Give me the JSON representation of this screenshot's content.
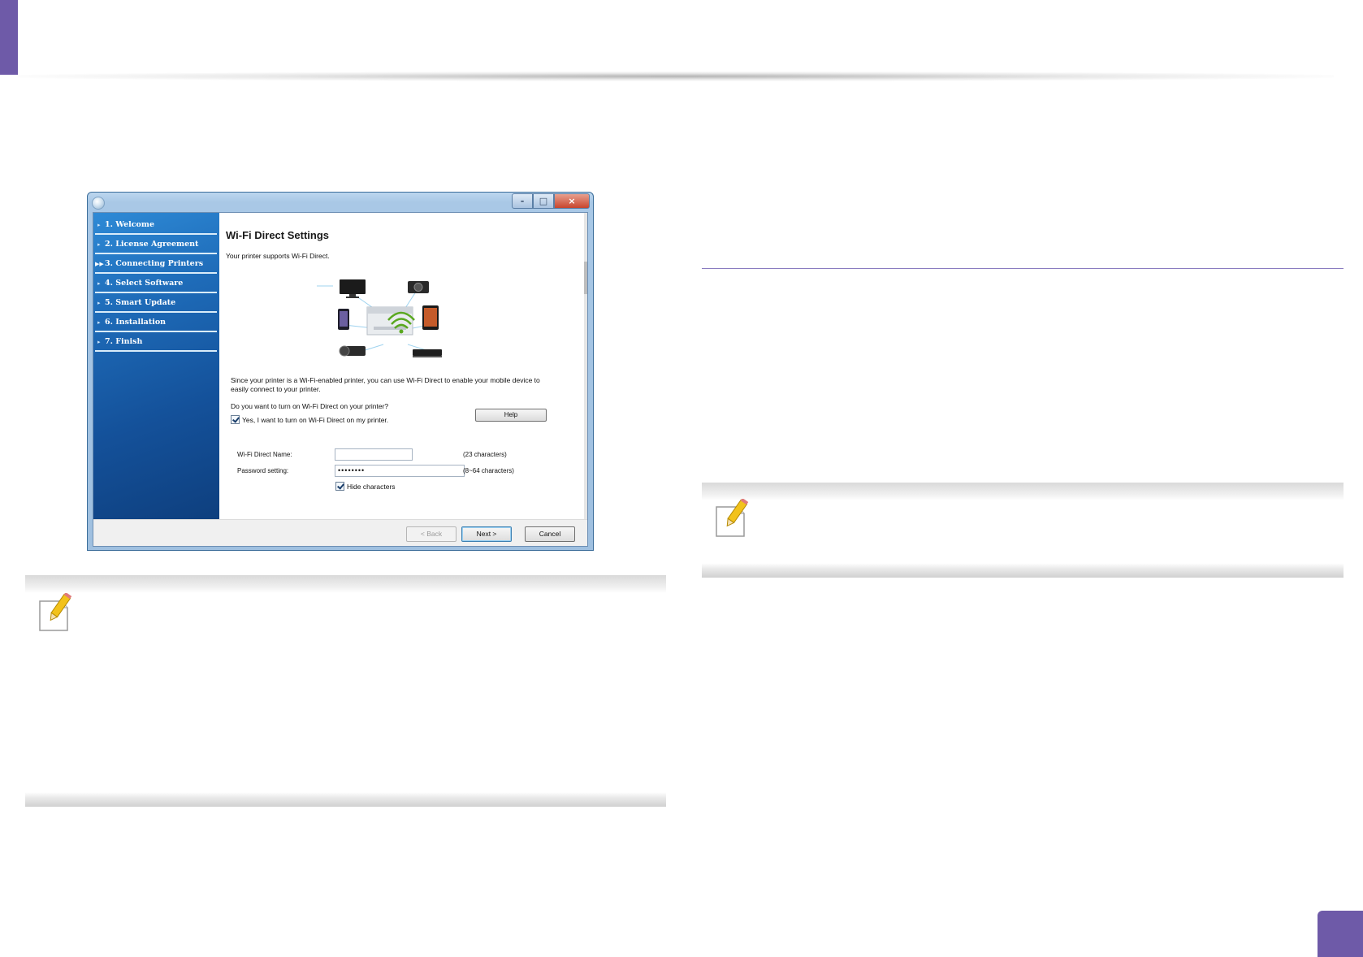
{
  "installer": {
    "steps": [
      {
        "label": "1. Welcome",
        "current": false
      },
      {
        "label": "2. License Agreement",
        "current": false
      },
      {
        "label": "3. Connecting Printers",
        "current": true
      },
      {
        "label": "4. Select Software",
        "current": false
      },
      {
        "label": "5. Smart Update",
        "current": false
      },
      {
        "label": "6. Installation",
        "current": false
      },
      {
        "label": "7. Finish",
        "current": false
      }
    ],
    "title": "Wi-Fi Direct Settings",
    "subtitle": "Your printer supports Wi-Fi Direct.",
    "description": "Since your printer is a Wi-Fi-enabled printer, you can use Wi-Fi Direct to enable your mobile device to easily connect to your printer.",
    "question": "Do you want to turn on Wi-Fi Direct on your printer?",
    "enable_checkbox": {
      "label": "Yes, I want to turn on Wi-Fi Direct on my printer.",
      "checked": true
    },
    "help_button": "Help",
    "fields": {
      "name_label": "Wi-Fi Direct Name:",
      "name_value": "",
      "name_hint": "(23 characters)",
      "password_label": "Password setting:",
      "password_value": "••••••••",
      "password_hint": "(8~64 characters)"
    },
    "hide_checkbox": {
      "label": "Hide characters",
      "checked": true
    },
    "buttons": {
      "back": "< Back",
      "next": "Next >",
      "cancel": "Cancel"
    },
    "window_controls": {
      "minimize": "-",
      "maximize": "□",
      "close": "×"
    }
  },
  "colors": {
    "accent": "#6e5aa8",
    "sidebar": "#1e6bb8",
    "note_band": "#d9d9d9"
  },
  "icons": [
    "pencil-note-icon",
    "app-orb-icon",
    "printer-icon",
    "monitor-icon",
    "camera-icon",
    "phone-icon",
    "tablet-icon",
    "camcorder-icon",
    "media-player-icon",
    "wifi-icon"
  ]
}
